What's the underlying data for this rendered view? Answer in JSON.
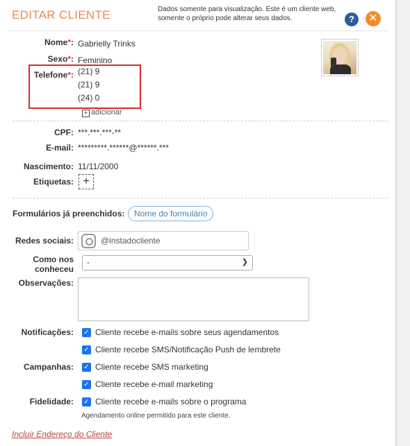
{
  "header": {
    "title": "EDITAR CLIENTE",
    "notice": "Dados somente para visualização. Este é um cliente web, somente o próprio pode alterar seus dados.",
    "help_glyph": "?",
    "close_glyph": "✕"
  },
  "client": {
    "name_label": "Nome",
    "name": "Gabrielly Trinks",
    "gender_label": "Sexo",
    "gender": "Feminino",
    "phone_label": "Telefone",
    "phones": [
      "(21) 9",
      "(21) 9",
      "(24) 0"
    ],
    "add_phone": "adicionar",
    "required_mark": "*",
    "cpf_label": "CPF:",
    "cpf": "***.***.***-**",
    "email_label": "E-mail:",
    "email": "*********.******@******.***",
    "birth_label": "Nascimento:",
    "birth": "11/11/2000",
    "tags_label": "Etiquetas:"
  },
  "forms": {
    "label": "Formulários já preenchidos:",
    "pill": "Nome do formulário"
  },
  "social": {
    "label": "Redes sociais:",
    "value": "@instadocliente"
  },
  "referral": {
    "label_line1": "Como nos",
    "label_line2": "conheceu",
    "selected": "-"
  },
  "notes": {
    "label": "Observações:",
    "value": ""
  },
  "preferences": {
    "notifications_label": "Notificações:",
    "campaigns_label": "Campanhas:",
    "loyalty_label": "Fidelidade:",
    "items": [
      "Cliente recebe e-mails sobre seus agendamentos",
      "Cliente recebe SMS/Notificação Push de lembrete",
      "Cliente recebe SMS marketing",
      "Cliente recebe e-mail marketing",
      "Cliente recebe e-mails sobre o programa"
    ],
    "online_note": "Agendamento online permitido para este cliente."
  },
  "footer": {
    "address_link": "Incluir Endereço do Cliente"
  },
  "colors": {
    "accent": "#e88a4c",
    "close": "#f28c28",
    "help": "#2f5c9e",
    "checkbox": "#1a73e8",
    "highlight": "#d42a2a"
  }
}
